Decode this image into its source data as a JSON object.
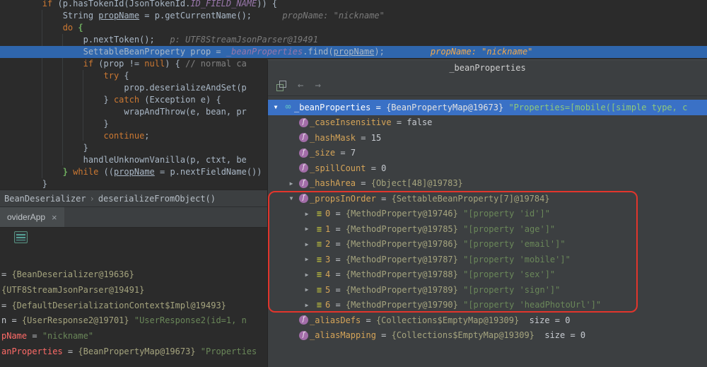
{
  "colors": {
    "editor_bg": "#2B2B2B",
    "panel_bg": "#3C3F41",
    "execution_line": "#2F66AD",
    "selection_blue": "#3A71C6",
    "annotation_red": "#E2352C",
    "string_green": "#6A8759",
    "field_purple": "#9876AA",
    "keyword_orange": "#CC7832",
    "changed_red": "#FF6B68"
  },
  "icons": {
    "chevron_down": "▼",
    "chevron_right": "▶",
    "watch": "∞",
    "field": "f",
    "element": "≡",
    "back": "←",
    "forward": "→",
    "close": "×"
  },
  "editor": {
    "lines": [
      {
        "seg": [
          [
            "def",
            "        "
          ],
          [
            "kw",
            "if"
          ],
          [
            "def",
            " (p.hasTokenId(JsonTokenId."
          ],
          [
            "fld",
            "ID_FIELD_NAME"
          ],
          [
            "def",
            ")) {"
          ]
        ]
      },
      {
        "seg": [
          [
            "def",
            "            String "
          ],
          [
            "und",
            "propName"
          ],
          [
            "def",
            " = p.getCurrentName();"
          ],
          [
            "hint",
            "      propName: \"nickname\""
          ]
        ]
      },
      {
        "seg": [
          [
            "def",
            "            "
          ],
          [
            "kw",
            "do"
          ],
          [
            "match",
            " {"
          ]
        ]
      },
      {
        "seg": [
          [
            "def",
            "                p.nextToken();"
          ],
          [
            "hint",
            "   p: UTF8StreamJsonParser@19491"
          ]
        ]
      },
      {
        "seg": [
          [
            "def",
            "                SettableBeanProperty prop = "
          ],
          [
            "fld",
            "_beanProperties"
          ],
          [
            "def",
            ".find("
          ],
          [
            "und",
            "propName"
          ],
          [
            "def",
            ");"
          ],
          [
            "hintO",
            "         propName: \"nickname\""
          ]
        ]
      },
      {
        "seg": [
          [
            "def",
            "                "
          ],
          [
            "kw",
            "if"
          ],
          [
            "def",
            " (prop != "
          ],
          [
            "kw",
            "null"
          ],
          [
            "def",
            ") { "
          ],
          [
            "cmt",
            "// normal ca"
          ]
        ]
      },
      {
        "seg": [
          [
            "def",
            "                    "
          ],
          [
            "kw",
            "try"
          ],
          [
            "def",
            " {"
          ]
        ]
      },
      {
        "seg": [
          [
            "def",
            "                        prop.deserializeAndSet(p"
          ]
        ]
      },
      {
        "seg": [
          [
            "def",
            "                    } "
          ],
          [
            "kw",
            "catch"
          ],
          [
            "def",
            " (Exception e) {"
          ]
        ]
      },
      {
        "seg": [
          [
            "def",
            "                        wrapAndThrow(e, bean, pr"
          ]
        ]
      },
      {
        "seg": [
          [
            "def",
            "                    }"
          ]
        ]
      },
      {
        "seg": [
          [
            "def",
            "                    "
          ],
          [
            "kw",
            "continue"
          ],
          [
            "def",
            ";"
          ]
        ]
      },
      {
        "seg": [
          [
            "def",
            "                }"
          ]
        ]
      },
      {
        "seg": [
          [
            "def",
            "                handleUnknownVanilla(p, ctxt, be"
          ]
        ]
      },
      {
        "seg": [
          [
            "def",
            "            "
          ],
          [
            "match",
            "}"
          ],
          [
            "def",
            " "
          ],
          [
            "kw",
            "while"
          ],
          [
            "def",
            " (("
          ],
          [
            "und",
            "propName"
          ],
          [
            "def",
            " = p.nextFieldName())"
          ]
        ]
      },
      {
        "seg": [
          [
            "def",
            "        }"
          ]
        ]
      }
    ]
  },
  "breadcrumb": {
    "class_name": "BeanDeserializer",
    "separator": "›",
    "method_name": "deserializeFromObject()"
  },
  "tabs": {
    "label": "oviderApp"
  },
  "variables_panel": {
    "rows": [
      {
        "seg": [
          [
            "eq",
            "= "
          ],
          [
            "vref",
            "{BeanDeserializer@19636}"
          ]
        ]
      },
      {
        "seg": [
          [
            "vref",
            "{UTF8StreamJsonParser@19491}"
          ]
        ]
      },
      {
        "seg": [
          [
            "eq",
            "= "
          ],
          [
            "vref",
            "{DefaultDeserializationContext$Impl@19493}"
          ]
        ]
      },
      {
        "seg": [
          [
            "vval",
            "n = "
          ],
          [
            "vref",
            "{UserResponse2@19701} "
          ],
          [
            "vstr",
            "\"UserResponse2(id=1, n"
          ]
        ]
      },
      {
        "seg": [
          [
            "red",
            "pName"
          ],
          [
            "eq",
            " = "
          ],
          [
            "vstr",
            "\"nickname\""
          ]
        ]
      },
      {
        "seg": [
          [
            "red",
            "anProperties"
          ],
          [
            "eq",
            " = "
          ],
          [
            "vref",
            "{BeanPropertyMap@19673} "
          ],
          [
            "vstr",
            "\"Properties"
          ]
        ]
      }
    ]
  },
  "watches_panel": {
    "title": "_beanProperties",
    "rows": [
      {
        "a": "d",
        "ic": "w",
        "ind": 2,
        "sel": true,
        "seg": [
          [
            "vname",
            "_beanProperties"
          ],
          [
            "eq",
            " = "
          ],
          [
            "vref",
            "{BeanPropertyMap@19673} "
          ],
          [
            "vstr",
            "\"Properties=[mobile([simple type, c"
          ]
        ]
      },
      {
        "a": "",
        "ic": "f",
        "ind": 24,
        "seg": [
          [
            "vname",
            "_caseInsensitive"
          ],
          [
            "eq",
            " = "
          ],
          [
            "vval",
            "false"
          ]
        ]
      },
      {
        "a": "",
        "ic": "f",
        "ind": 24,
        "seg": [
          [
            "vname",
            "_hashMask"
          ],
          [
            "eq",
            " = "
          ],
          [
            "vval",
            "15"
          ]
        ]
      },
      {
        "a": "",
        "ic": "f",
        "ind": 24,
        "seg": [
          [
            "vname",
            "_size"
          ],
          [
            "eq",
            " = "
          ],
          [
            "vval",
            "7"
          ]
        ]
      },
      {
        "a": "",
        "ic": "f",
        "ind": 24,
        "seg": [
          [
            "vname",
            "_spillCount"
          ],
          [
            "eq",
            " = "
          ],
          [
            "vval",
            "0"
          ]
        ]
      },
      {
        "a": "r",
        "ic": "f",
        "ind": 24,
        "seg": [
          [
            "vname",
            "_hashArea"
          ],
          [
            "eq",
            " = "
          ],
          [
            "vref",
            "{Object[48]@19783}"
          ]
        ]
      },
      {
        "a": "d",
        "ic": "f",
        "ind": 24,
        "seg": [
          [
            "vname",
            "_propsInOrder"
          ],
          [
            "eq",
            " = "
          ],
          [
            "vref",
            "{SettableBeanProperty[7]@19784}"
          ]
        ]
      },
      {
        "a": "r",
        "ic": "e",
        "ind": 46,
        "seg": [
          [
            "vname",
            "0"
          ],
          [
            "eq",
            " = "
          ],
          [
            "vref",
            "{MethodProperty@19746} "
          ],
          [
            "vstr",
            "\"[property 'id']\""
          ]
        ]
      },
      {
        "a": "r",
        "ic": "e",
        "ind": 46,
        "seg": [
          [
            "vname",
            "1"
          ],
          [
            "eq",
            " = "
          ],
          [
            "vref",
            "{MethodProperty@19785} "
          ],
          [
            "vstr",
            "\"[property 'age']\""
          ]
        ]
      },
      {
        "a": "r",
        "ic": "e",
        "ind": 46,
        "seg": [
          [
            "vname",
            "2"
          ],
          [
            "eq",
            " = "
          ],
          [
            "vref",
            "{MethodProperty@19786} "
          ],
          [
            "vstr",
            "\"[property 'email']\""
          ]
        ]
      },
      {
        "a": "r",
        "ic": "e",
        "ind": 46,
        "seg": [
          [
            "vname",
            "3"
          ],
          [
            "eq",
            " = "
          ],
          [
            "vref",
            "{MethodProperty@19787} "
          ],
          [
            "vstr",
            "\"[property 'mobile']\""
          ]
        ]
      },
      {
        "a": "r",
        "ic": "e",
        "ind": 46,
        "seg": [
          [
            "vname",
            "4"
          ],
          [
            "eq",
            " = "
          ],
          [
            "vref",
            "{MethodProperty@19788} "
          ],
          [
            "vstr",
            "\"[property 'sex']\""
          ]
        ]
      },
      {
        "a": "r",
        "ic": "e",
        "ind": 46,
        "seg": [
          [
            "vname",
            "5"
          ],
          [
            "eq",
            " = "
          ],
          [
            "vref",
            "{MethodProperty@19789} "
          ],
          [
            "vstr",
            "\"[property 'sign']\""
          ]
        ]
      },
      {
        "a": "r",
        "ic": "e",
        "ind": 46,
        "seg": [
          [
            "vname",
            "6"
          ],
          [
            "eq",
            " = "
          ],
          [
            "vref",
            "{MethodProperty@19790} "
          ],
          [
            "vstr",
            "\"[property 'headPhotoUrl']\""
          ]
        ]
      },
      {
        "a": "",
        "ic": "f",
        "ind": 24,
        "seg": [
          [
            "vname",
            "_aliasDefs"
          ],
          [
            "eq",
            " = "
          ],
          [
            "vref",
            "{Collections$EmptyMap@19309}"
          ],
          [
            "vval",
            "  size = 0"
          ]
        ]
      },
      {
        "a": "",
        "ic": "f",
        "ind": 24,
        "seg": [
          [
            "vname",
            "_aliasMapping"
          ],
          [
            "eq",
            " = "
          ],
          [
            "vref",
            "{Collections$EmptyMap@19309}"
          ],
          [
            "vval",
            "  size = 0"
          ]
        ]
      }
    ]
  }
}
